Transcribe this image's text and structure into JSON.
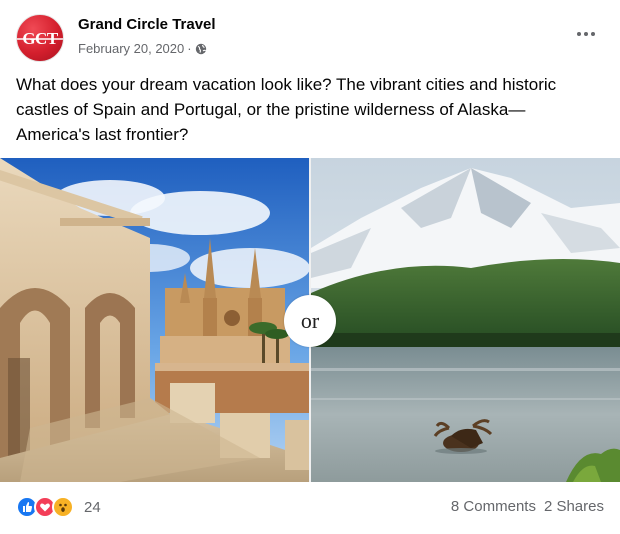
{
  "post": {
    "avatar_text": "GCT",
    "page_name": "Grand Circle Travel",
    "date": "February 20, 2020",
    "separator": "·",
    "body": "What does your dream vacation look like? The vibrant cities and historic castles of Spain and Portugal, or the pristine wilderness of Alaska—America's last frontier?",
    "image_badge": "or"
  },
  "footer": {
    "reaction_count": "24",
    "comments": "8 Comments",
    "shares": "2 Shares"
  },
  "icons": {
    "privacy": "globe-icon",
    "more": "more-options-icon",
    "reactions": [
      "like-icon",
      "love-icon",
      "wow-icon"
    ]
  },
  "colors": {
    "avatar": "#d41f2d",
    "like": "#1877f2",
    "love": "#f33e58",
    "wow": "#f7b125",
    "secondary_text": "#65676b"
  }
}
